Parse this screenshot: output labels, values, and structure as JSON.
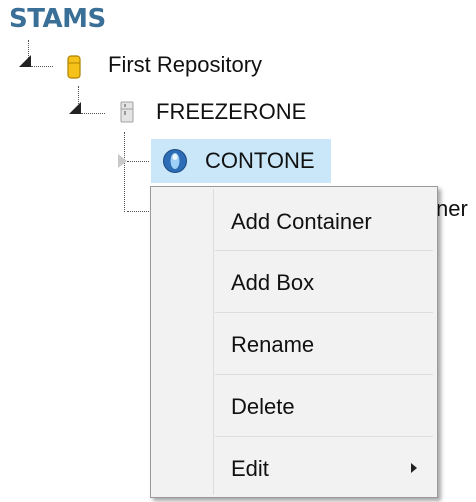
{
  "app": {
    "title": "STAMS"
  },
  "tree": {
    "repository": {
      "label": "First Repository",
      "icon": "repository-icon"
    },
    "freezer": {
      "label": "FREEZERONE",
      "icon": "freezer-icon"
    },
    "container": {
      "label": "CONTONE",
      "icon": "container-icon",
      "selected": true
    },
    "partial_sibling": {
      "label": "ner"
    }
  },
  "context_menu": {
    "items": [
      {
        "label": "Add Container"
      },
      {
        "label": "Add Box"
      },
      {
        "label": "Rename"
      },
      {
        "label": "Delete"
      },
      {
        "label": "Edit",
        "has_submenu": true
      }
    ]
  },
  "colors": {
    "title": "#3a6f97",
    "selection": "#c9e7f8",
    "menu_bg": "#f2f2f2"
  }
}
